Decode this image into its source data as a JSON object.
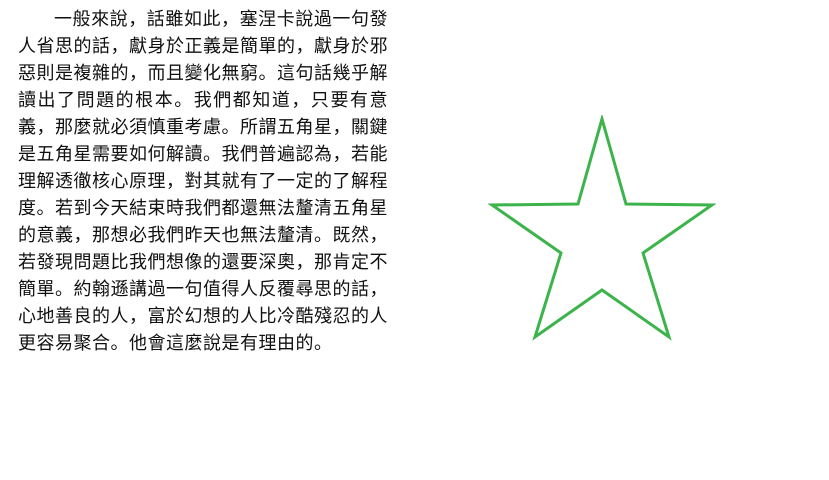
{
  "paragraph": "一般來說，話雖如此，塞涅卡說過一句發人省思的話，獻身於正義是簡單的，獻身於邪惡則是複雜的，而且變化無窮。這句話幾乎解讀出了問題的根本。我們都知道，只要有意義，那麼就必須慎重考慮。所謂五角星，關鍵是五角星需要如何解讀。我們普遍認為，若能理解透徹核心原理，對其就有了一定的了解程度。若到今天結束時我們都還無法釐清五角星的意義，那想必我們昨天也無法釐清。既然，若發現問題比我們想像的還要深奧，那肯定不簡單。約翰遜講過一句值得人反覆尋思的話，心地善良的人，富於幻想的人比冷酷殘忍的人更容易聚合。他會這麼說是有理由的。",
  "star": {
    "shape": "five-pointed-star",
    "stroke_color": "#3cb44b",
    "fill": "none"
  }
}
